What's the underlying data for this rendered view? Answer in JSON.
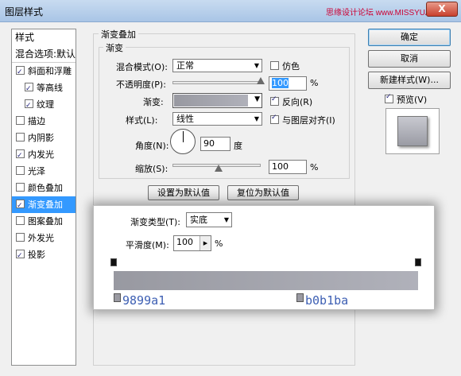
{
  "window": {
    "title": "图层样式",
    "watermark": "思缘设计论坛 www.MISSYUAN.COM",
    "close_glyph": "X"
  },
  "left_panel": {
    "items": [
      {
        "label": "样式",
        "checkbox": null,
        "selected": false,
        "header": true
      },
      {
        "label": "混合选项:默认",
        "checkbox": null,
        "selected": false,
        "header": true
      },
      {
        "label": "斜面和浮雕",
        "checkbox": true,
        "selected": false,
        "indent": false
      },
      {
        "label": "等高线",
        "checkbox": true,
        "selected": false,
        "indent": true
      },
      {
        "label": "纹理",
        "checkbox": true,
        "selected": false,
        "indent": true
      },
      {
        "label": "描边",
        "checkbox": false,
        "selected": false,
        "indent": false
      },
      {
        "label": "内阴影",
        "checkbox": false,
        "selected": false,
        "indent": false
      },
      {
        "label": "内发光",
        "checkbox": true,
        "selected": false,
        "indent": false
      },
      {
        "label": "光泽",
        "checkbox": false,
        "selected": false,
        "indent": false
      },
      {
        "label": "颜色叠加",
        "checkbox": false,
        "selected": false,
        "indent": false
      },
      {
        "label": "渐变叠加",
        "checkbox": true,
        "selected": true,
        "indent": false
      },
      {
        "label": "图案叠加",
        "checkbox": false,
        "selected": false,
        "indent": false
      },
      {
        "label": "外发光",
        "checkbox": false,
        "selected": false,
        "indent": false
      },
      {
        "label": "投影",
        "checkbox": true,
        "selected": false,
        "indent": false
      }
    ]
  },
  "gradient_overlay": {
    "section_title": "渐变叠加",
    "subsection_title": "渐变",
    "blend_mode_label": "混合模式(O):",
    "blend_mode_value": "正常",
    "dither_label": "仿色",
    "dither_checked": false,
    "opacity_label": "不透明度(P):",
    "opacity_value": "100",
    "opacity_fraction": 1.0,
    "percent": "%",
    "gradient_label": "渐变:",
    "reverse_label": "反向(R)",
    "reverse_checked": true,
    "style_label": "样式(L):",
    "style_value": "线性",
    "align_label": "与图层对齐(I)",
    "align_checked": true,
    "angle_label": "角度(N):",
    "angle_value": "90",
    "angle_unit": "度",
    "scale_label": "缩放(S):",
    "scale_value": "100",
    "scale_fraction": 0.5,
    "set_default_button": "设置为默认值",
    "reset_default_button": "复位为默认值"
  },
  "right_buttons": {
    "ok": "确定",
    "cancel": "取消",
    "new_style": "新建样式(W)...",
    "preview_label": "预览(V)",
    "preview_checked": true
  },
  "gradient_editor": {
    "type_label": "渐变类型(T):",
    "type_value": "实底",
    "smoothness_label": "平滑度(M):",
    "smoothness_value": "100",
    "smoothness_unit": "%",
    "color_stops": [
      {
        "hex": "9899a1",
        "color": "#9899a1",
        "location": 0
      },
      {
        "hex": "b0b1ba",
        "color": "#b0b1ba",
        "location": 1
      }
    ]
  }
}
